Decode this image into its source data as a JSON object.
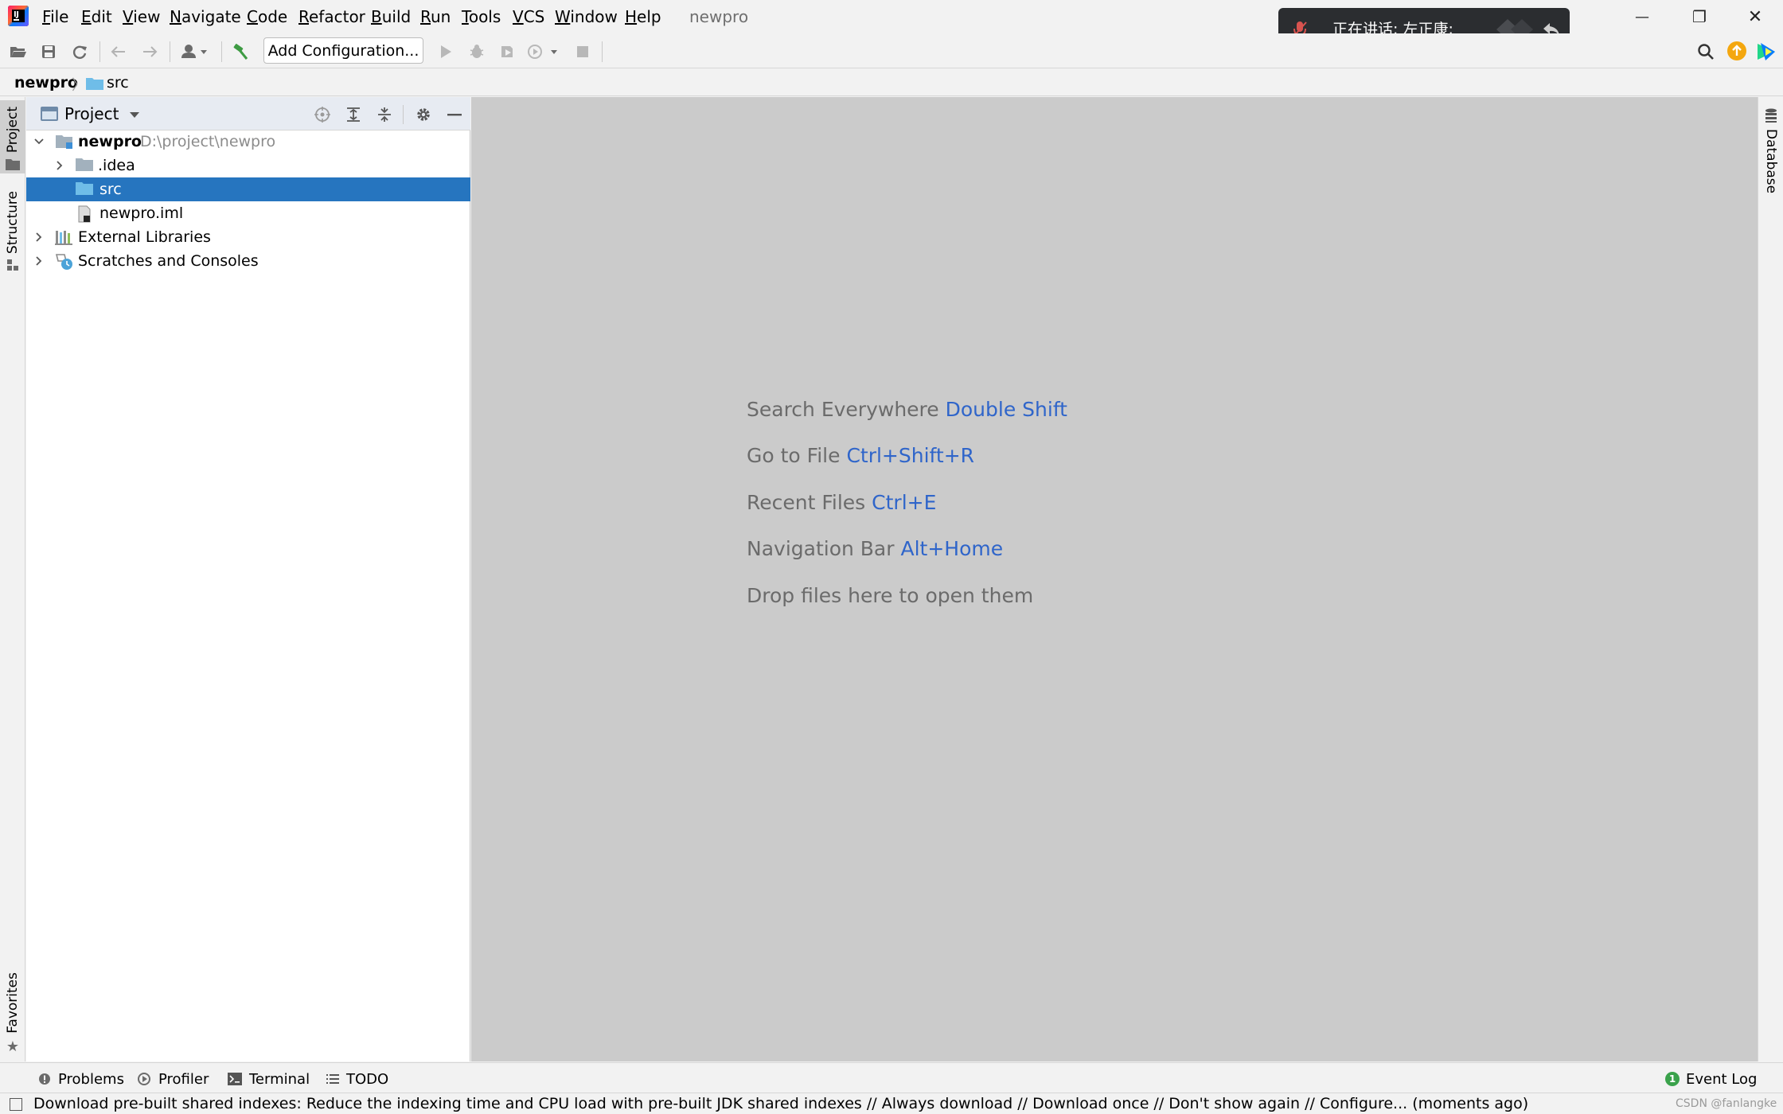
{
  "window": {
    "project_title": "newpro",
    "minimize_glyph": "—",
    "restore_glyph": "❐",
    "close_glyph": "✕"
  },
  "menu": {
    "items": [
      "File",
      "Edit",
      "View",
      "Navigate",
      "Code",
      "Refactor",
      "Build",
      "Run",
      "Tools",
      "VCS",
      "Window",
      "Help"
    ]
  },
  "toolbar": {
    "add_configuration": "Add Configuration..."
  },
  "breadcrumb": {
    "root": "newpro",
    "separator": "〉",
    "child": "src"
  },
  "left_strip": {
    "project": "Project",
    "structure": "Structure",
    "favorites": "Favorites"
  },
  "right_strip": {
    "database": "Database"
  },
  "project_panel": {
    "title": "Project",
    "tree": [
      {
        "label": "newpro",
        "path": "D:\\project\\newpro"
      },
      {
        "label": ".idea"
      },
      {
        "label": "src"
      },
      {
        "label": "newpro.iml"
      },
      {
        "label": "External Libraries"
      },
      {
        "label": "Scratches and Consoles"
      }
    ]
  },
  "editor_hints": [
    {
      "text": "Search Everywhere",
      "key": "Double Shift"
    },
    {
      "text": "Go to File",
      "key": "Ctrl+Shift+R"
    },
    {
      "text": "Recent Files",
      "key": "Ctrl+E"
    },
    {
      "text": "Navigation Bar",
      "key": "Alt+Home"
    },
    {
      "text": "Drop files here to open them",
      "key": ""
    }
  ],
  "bottom_tools": {
    "problems": "Problems",
    "profiler": "Profiler",
    "terminal": "Terminal",
    "todo": "TODO",
    "event_log": "Event Log",
    "event_count": "1"
  },
  "status": {
    "message": "Download pre-built shared indexes: Reduce the indexing time and CPU load with pre-built JDK shared indexes // Always download // Download once // Don't show again // Configure... (moments ago)",
    "watermark": "CSDN @fanlangke"
  },
  "toast": {
    "text": "正在讲话: 左正康;"
  },
  "colors": {
    "selection": "#2675bf",
    "shortcut": "#2f65ca",
    "editor_bg": "#cbcbcb"
  }
}
